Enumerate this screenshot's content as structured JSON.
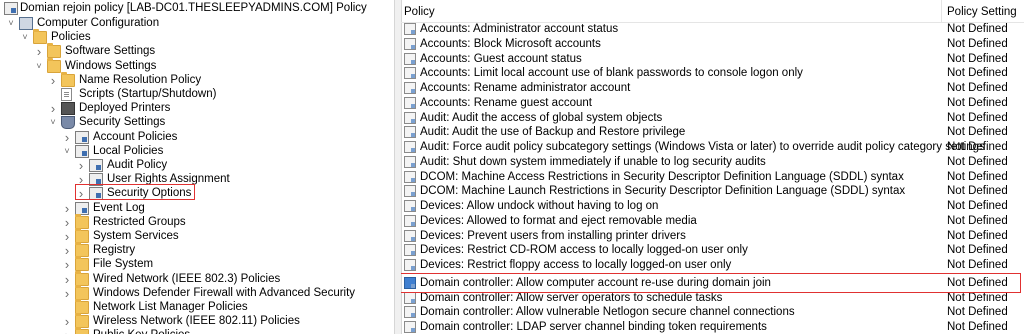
{
  "tree": {
    "title": "Domian rejoin policy [LAB-DC01.THESLEEPYADMINS.COM] Policy",
    "items": [
      {
        "label": "Computer Configuration",
        "icon": "computer-icon",
        "expander": "v"
      },
      {
        "label": "Policies",
        "icon": "folder-icon",
        "expander": "v"
      },
      {
        "label": "Software Settings",
        "icon": "folder-icon",
        "expander": ">"
      },
      {
        "label": "Windows Settings",
        "icon": "folder-icon",
        "expander": "v"
      },
      {
        "label": "Name Resolution Policy",
        "icon": "folder-icon",
        "expander": ">"
      },
      {
        "label": "Scripts (Startup/Shutdown)",
        "icon": "document-icon",
        "expander": ""
      },
      {
        "label": "Deployed Printers",
        "icon": "printer-icon",
        "expander": ">"
      },
      {
        "label": "Security Settings",
        "icon": "shield-icon",
        "expander": "v"
      },
      {
        "label": "Account Policies",
        "icon": "policy-icon",
        "expander": ">"
      },
      {
        "label": "Local Policies",
        "icon": "policy-icon",
        "expander": "v"
      },
      {
        "label": "Audit Policy",
        "icon": "policy-icon",
        "expander": ">"
      },
      {
        "label": "User Rights Assignment",
        "icon": "policy-icon",
        "expander": ">"
      },
      {
        "label": "Security Options",
        "icon": "policy-icon",
        "expander": ">"
      },
      {
        "label": "Event Log",
        "icon": "policy-icon",
        "expander": ">"
      },
      {
        "label": "Restricted Groups",
        "icon": "folder-icon",
        "expander": ">"
      },
      {
        "label": "System Services",
        "icon": "folder-icon",
        "expander": ">"
      },
      {
        "label": "Registry",
        "icon": "folder-icon",
        "expander": ">"
      },
      {
        "label": "File System",
        "icon": "folder-icon",
        "expander": ">"
      },
      {
        "label": "Wired Network (IEEE 802.3) Policies",
        "icon": "folder-icon",
        "expander": ">"
      },
      {
        "label": "Windows Defender Firewall with Advanced Security",
        "icon": "folder-icon",
        "expander": ">"
      },
      {
        "label": "Network List Manager Policies",
        "icon": "folder-icon",
        "expander": ""
      },
      {
        "label": "Wireless Network (IEEE 802.11) Policies",
        "icon": "folder-icon",
        "expander": ">"
      },
      {
        "label": "Public Key Policies",
        "icon": "folder-icon",
        "expander": ">"
      }
    ]
  },
  "list": {
    "col_policy": "Policy",
    "col_setting": "Policy Setting",
    "rows": [
      {
        "policy": "Accounts: Administrator account status",
        "setting": "Not Defined"
      },
      {
        "policy": "Accounts: Block Microsoft accounts",
        "setting": "Not Defined"
      },
      {
        "policy": "Accounts: Guest account status",
        "setting": "Not Defined"
      },
      {
        "policy": "Accounts: Limit local account use of blank passwords to console logon only",
        "setting": "Not Defined"
      },
      {
        "policy": "Accounts: Rename administrator account",
        "setting": "Not Defined"
      },
      {
        "policy": "Accounts: Rename guest account",
        "setting": "Not Defined"
      },
      {
        "policy": "Audit: Audit the access of global system objects",
        "setting": "Not Defined"
      },
      {
        "policy": "Audit: Audit the use of Backup and Restore privilege",
        "setting": "Not Defined"
      },
      {
        "policy": "Audit: Force audit policy subcategory settings (Windows Vista or later) to override audit policy category settings",
        "setting": "Not Defined"
      },
      {
        "policy": "Audit: Shut down system immediately if unable to log security audits",
        "setting": "Not Defined"
      },
      {
        "policy": "DCOM: Machine Access Restrictions in Security Descriptor Definition Language (SDDL) syntax",
        "setting": "Not Defined"
      },
      {
        "policy": "DCOM: Machine Launch Restrictions in Security Descriptor Definition Language (SDDL) syntax",
        "setting": "Not Defined"
      },
      {
        "policy": "Devices: Allow undock without having to log on",
        "setting": "Not Defined"
      },
      {
        "policy": "Devices: Allowed to format and eject removable media",
        "setting": "Not Defined"
      },
      {
        "policy": "Devices: Prevent users from installing printer drivers",
        "setting": "Not Defined"
      },
      {
        "policy": "Devices: Restrict CD-ROM access to locally logged-on user only",
        "setting": "Not Defined"
      },
      {
        "policy": "Devices: Restrict floppy access to locally logged-on user only",
        "setting": "Not Defined"
      },
      {
        "policy": "Domain controller: Allow computer account re-use during domain join",
        "setting": "Not Defined"
      },
      {
        "policy": "Domain controller: Allow server operators to schedule tasks",
        "setting": "Not Defined"
      },
      {
        "policy": "Domain controller: Allow vulnerable Netlogon secure channel connections",
        "setting": "Not Defined"
      },
      {
        "policy": "Domain controller: LDAP server channel binding token requirements",
        "setting": "Not Defined"
      }
    ]
  },
  "colors": {
    "highlight_box": "#e03131",
    "folder": "#f3c55b"
  }
}
